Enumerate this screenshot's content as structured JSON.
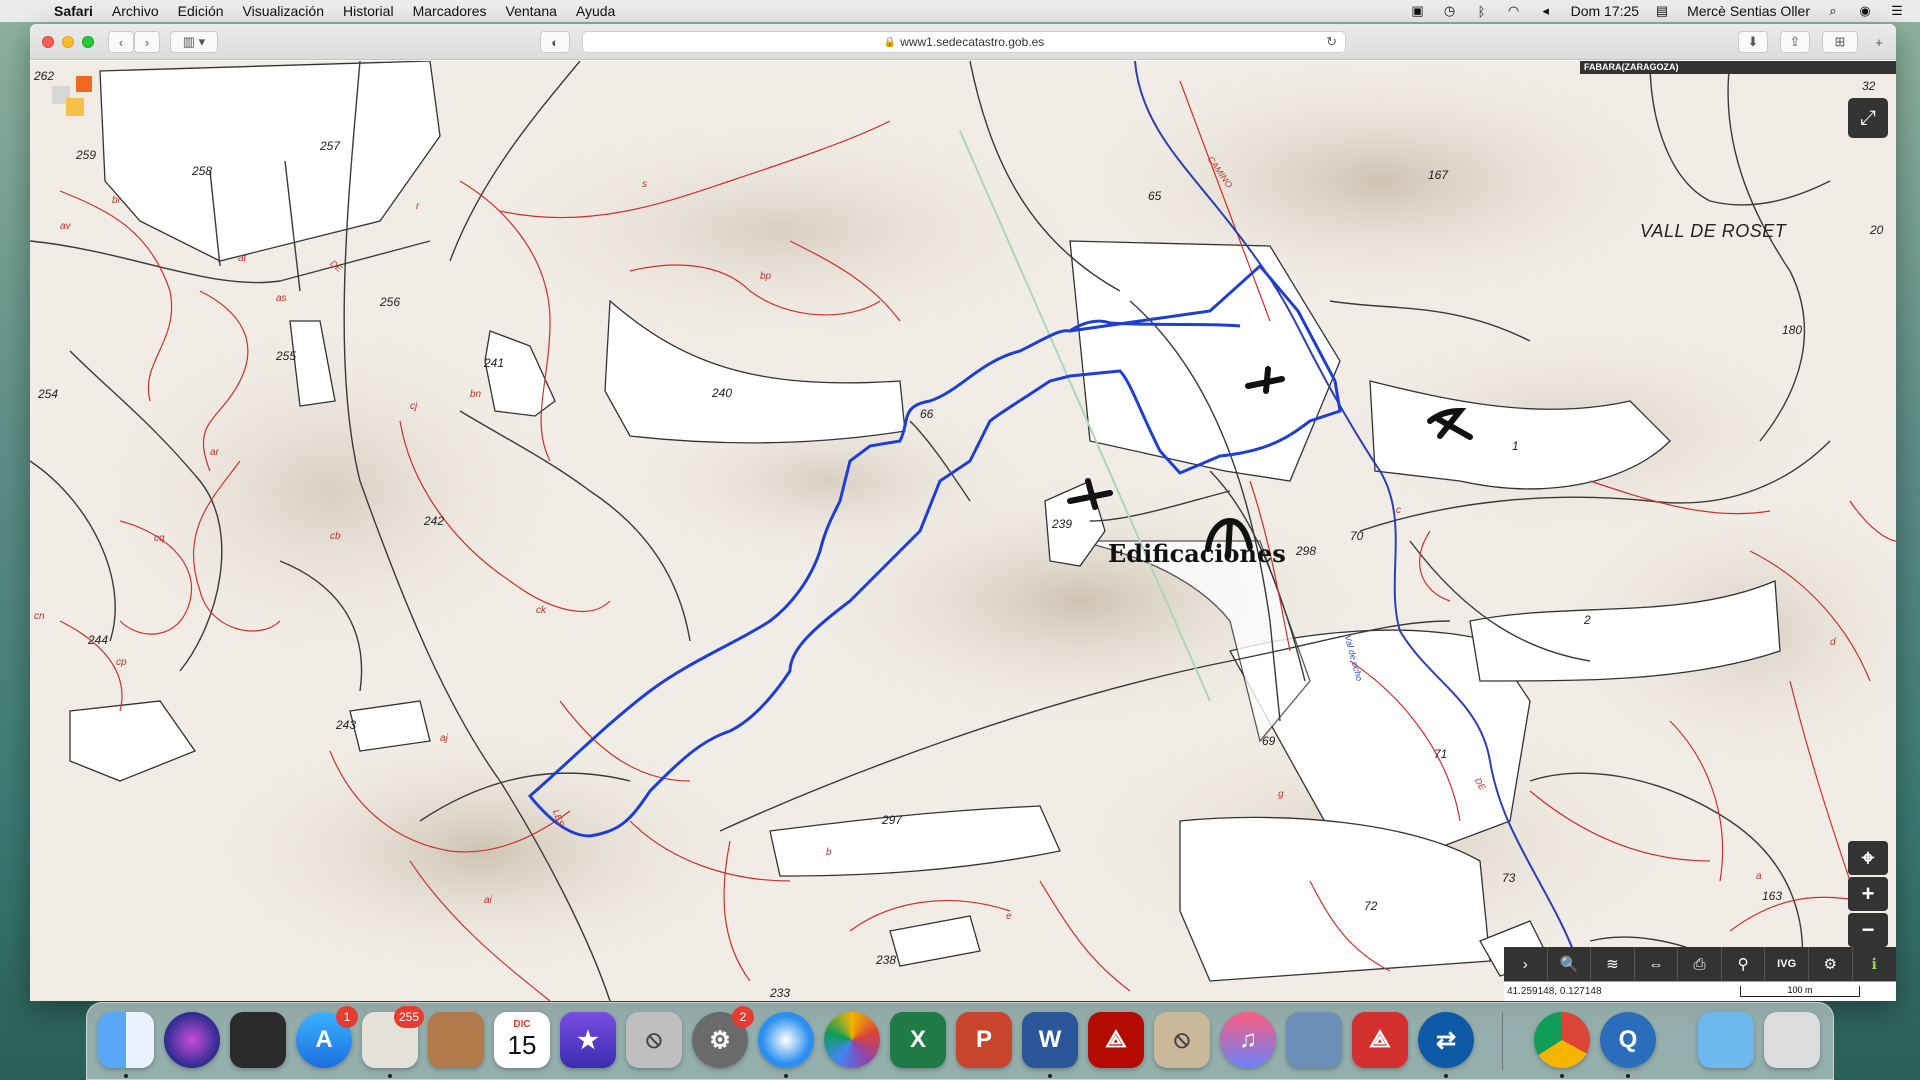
{
  "menubar": {
    "app_name": "Safari",
    "menus": [
      "Archivo",
      "Edición",
      "Visualización",
      "Historial",
      "Marcadores",
      "Ventana",
      "Ayuda"
    ],
    "clock": "Dom 17:25",
    "user": "Mercè Sentias Oller"
  },
  "browser": {
    "url": "www1.sedecatastro.gob.es"
  },
  "map": {
    "region_tag": "FABARA(ZARAGOZA)",
    "place_name": "VALL DE ROSET",
    "annotation": "Edificaciones",
    "parcel_numbers": [
      {
        "text": "262"
      },
      {
        "text": "259"
      },
      {
        "text": "258"
      },
      {
        "text": "257"
      },
      {
        "text": "256"
      },
      {
        "text": "255"
      },
      {
        "text": "254"
      },
      {
        "text": "241"
      },
      {
        "text": "240"
      },
      {
        "text": "242"
      },
      {
        "text": "244"
      },
      {
        "text": "243"
      },
      {
        "text": "66"
      },
      {
        "text": "65"
      },
      {
        "text": "239"
      },
      {
        "text": "298"
      },
      {
        "text": "297"
      },
      {
        "text": "238"
      },
      {
        "text": "233"
      },
      {
        "text": "69"
      },
      {
        "text": "70"
      },
      {
        "text": "71"
      },
      {
        "text": "72"
      },
      {
        "text": "73"
      },
      {
        "text": "167"
      },
      {
        "text": "180"
      },
      {
        "text": "20"
      },
      {
        "text": "1"
      },
      {
        "text": "2"
      },
      {
        "text": "163"
      },
      {
        "text": "32"
      }
    ],
    "subparcel_letters": [
      {
        "text": "br"
      },
      {
        "text": "av"
      },
      {
        "text": "at"
      },
      {
        "text": "as"
      },
      {
        "text": "r"
      },
      {
        "text": "s"
      },
      {
        "text": "bp"
      },
      {
        "text": "bn"
      },
      {
        "text": "cj"
      },
      {
        "text": "ar"
      },
      {
        "text": "cq"
      },
      {
        "text": "cb"
      },
      {
        "text": "ck"
      },
      {
        "text": "cn"
      },
      {
        "text": "cp"
      },
      {
        "text": "aj"
      },
      {
        "text": "ai"
      },
      {
        "text": "b"
      },
      {
        "text": "e"
      },
      {
        "text": "g"
      },
      {
        "text": "c"
      },
      {
        "text": "d"
      },
      {
        "text": "a"
      }
    ],
    "road_labels": [
      "CAMINO",
      "DE",
      "LES",
      "DE"
    ],
    "stream_label": "Val de ocho",
    "coordinates": "41.259148, 0.127148",
    "scale": "100 m",
    "controls": {
      "locate": "⌖",
      "zoom_in": "+",
      "zoom_out": "−",
      "toolbar": [
        "›",
        "🔍",
        "≋",
        "⇔",
        "⎙",
        "⚲",
        "IVG",
        "⚙",
        "ℹ"
      ]
    }
  },
  "dock": {
    "badges": {
      "app_store": "1",
      "mail": "255",
      "calendar_day": "15",
      "calendar_month": "DIC",
      "system_prefs": "2"
    }
  },
  "colors": {
    "parcel_boundary": "#c4302b",
    "selection_outline": "#1f3fd1",
    "control_bg": "#333333"
  }
}
